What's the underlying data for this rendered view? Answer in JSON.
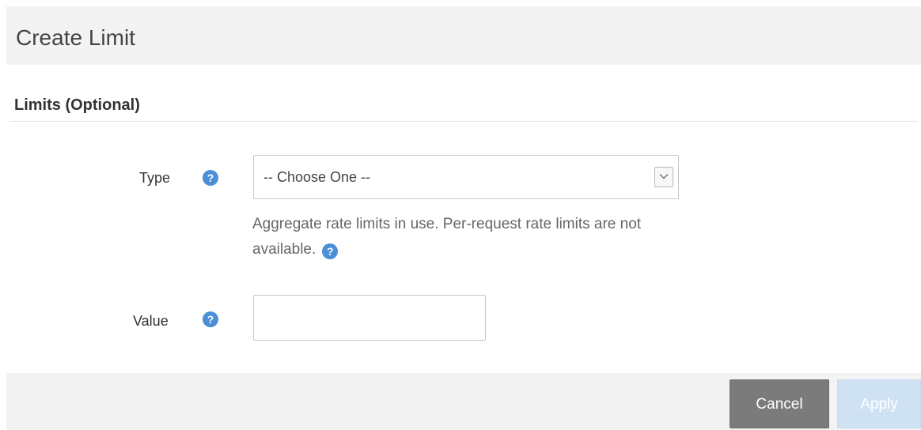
{
  "dialog": {
    "title": "Create Limit"
  },
  "section": {
    "title": "Limits (Optional)"
  },
  "fields": {
    "type": {
      "label": "Type",
      "selected": "-- Choose One --",
      "help_icon": "question-circle-icon",
      "dropdown_icon": "chevron-down-icon"
    },
    "hint": {
      "text": "Aggregate rate limits in use. Per-request rate limits are not available.",
      "help_icon": "question-circle-icon"
    },
    "value": {
      "label": "Value",
      "value": "",
      "help_icon": "question-circle-icon"
    }
  },
  "buttons": {
    "cancel": "Cancel",
    "apply": "Apply"
  },
  "colors": {
    "header_bg": "#f3f3f3",
    "help_icon": "#4b8fd6",
    "cancel_bg": "#7b7b7b",
    "apply_bg_disabled": "#cfe2f4"
  }
}
